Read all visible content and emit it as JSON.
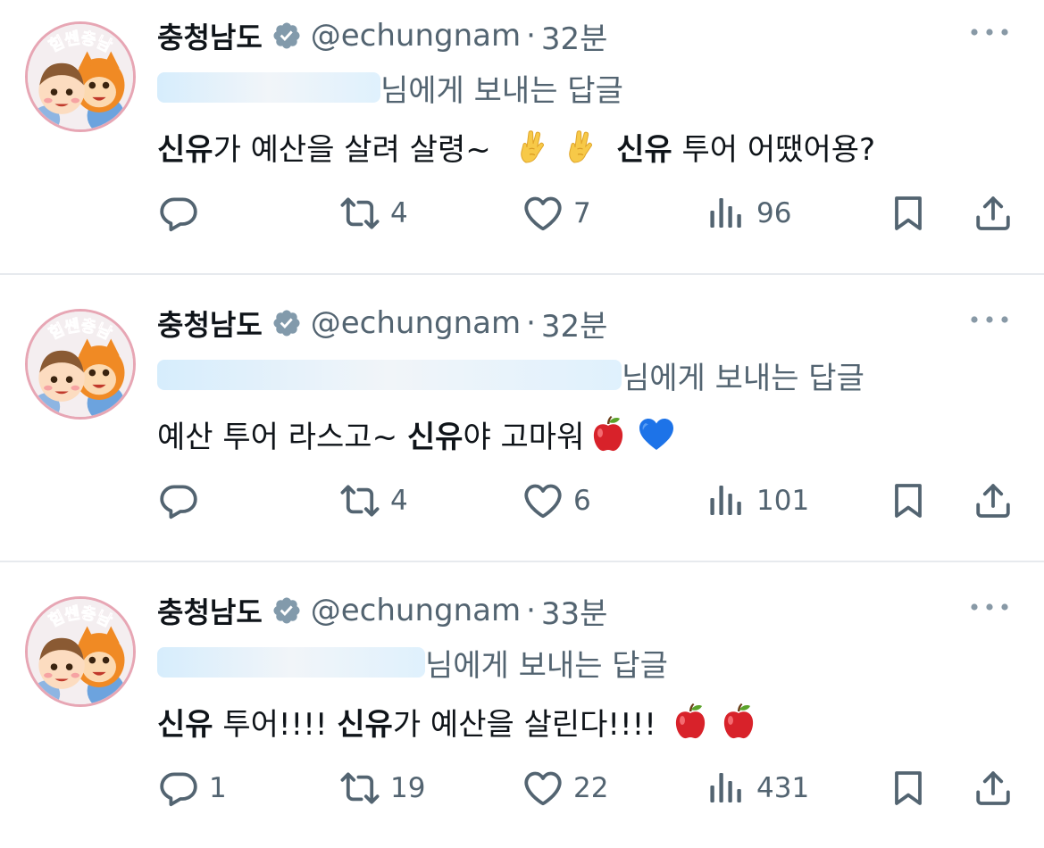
{
  "tweets": [
    {
      "author": "충청남도",
      "handle": "@echungnam",
      "dot": "·",
      "time": "32분",
      "reply_label": "님에게 보내는 답글",
      "text": [
        {
          "t": "신유",
          "b": true
        },
        {
          "t": "가 예산을 살려 살령~  ",
          "b": false
        },
        {
          "emoji": "crossed-fingers"
        },
        {
          "emoji": "crossed-fingers"
        },
        {
          "t": " ",
          "b": false
        },
        {
          "t": "신유",
          "b": true
        },
        {
          "t": " 투어 어땠어용?",
          "b": false
        }
      ],
      "counts": {
        "reply": "",
        "retweet": "4",
        "like": "7",
        "views": "96"
      }
    },
    {
      "author": "충청남도",
      "handle": "@echungnam",
      "dot": "·",
      "time": "32분",
      "reply_label": "님에게 보내는 답글",
      "text": [
        {
          "t": "예산 투어 라스고~ ",
          "b": false
        },
        {
          "t": "신유",
          "b": true
        },
        {
          "t": "야 고마워",
          "b": false
        },
        {
          "emoji": "red-apple"
        },
        {
          "emoji": "blue-heart"
        }
      ],
      "counts": {
        "reply": "",
        "retweet": "4",
        "like": "6",
        "views": "101"
      }
    },
    {
      "author": "충청남도",
      "handle": "@echungnam",
      "dot": "·",
      "time": "33분",
      "reply_label": "님에게 보내는 답글",
      "text": [
        {
          "t": "신유",
          "b": true
        },
        {
          "t": " 투어!!!! ",
          "b": false
        },
        {
          "t": "신유",
          "b": true
        },
        {
          "t": "가 예산을 살린다!!!! ",
          "b": false
        },
        {
          "emoji": "red-apple"
        },
        {
          "emoji": "red-apple"
        }
      ],
      "counts": {
        "reply": "1",
        "retweet": "19",
        "like": "22",
        "views": "431"
      }
    }
  ],
  "avatar_badge_text": "힘쎈충남",
  "icons": [
    "verified-badge-icon",
    "more-icon",
    "reply-icon",
    "retweet-icon",
    "like-icon",
    "views-icon",
    "bookmark-icon",
    "share-icon"
  ],
  "colors": {
    "secondary_text": "#536471",
    "primary_text": "#0f1419",
    "divider": "#e7eaee",
    "verified_badge": "#829aab"
  }
}
